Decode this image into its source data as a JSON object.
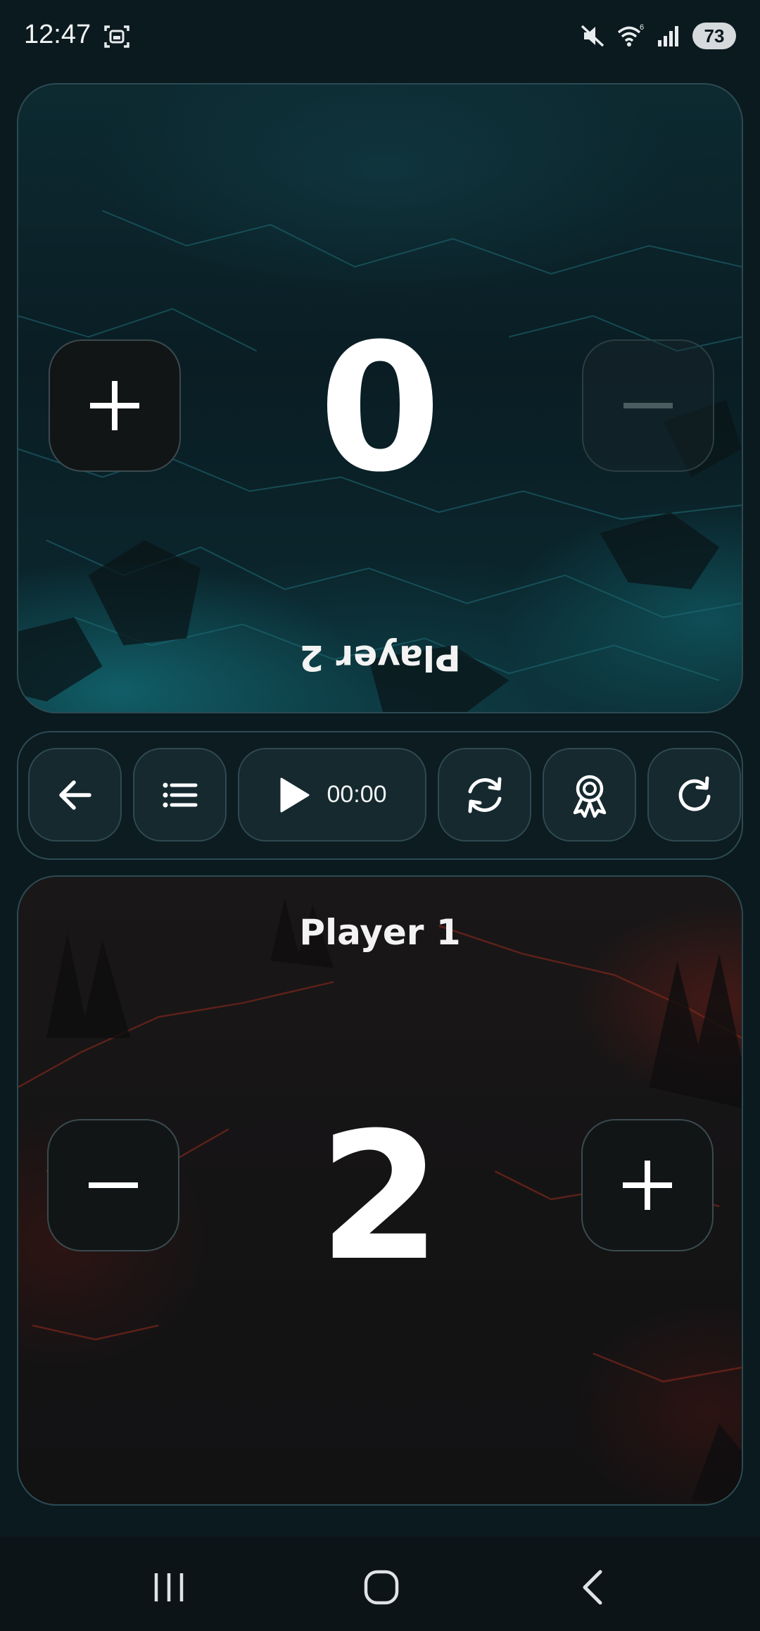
{
  "status_bar": {
    "time": "12:47",
    "battery": "73",
    "icons": [
      "screenshot-icon",
      "mute-icon",
      "wifi-icon",
      "signal-icon"
    ]
  },
  "player2": {
    "label": "Player 2",
    "score": "0",
    "theme": "teal-rock",
    "orientation": "upside-down",
    "buttons": [
      "plus-icon",
      "minus-icon"
    ]
  },
  "toolbar": {
    "timer": "00:00",
    "buttons": [
      "back-arrow-icon",
      "list-icon",
      "play-icon",
      "swap-icon",
      "award-icon",
      "reset-icon"
    ]
  },
  "player1": {
    "label": "Player 1",
    "score": "2",
    "theme": "lava-rock",
    "buttons": [
      "minus-icon",
      "plus-icon"
    ]
  },
  "nav_bar": {
    "buttons": [
      "recents-icon",
      "home-icon",
      "back-icon"
    ]
  },
  "colors": {
    "background": "#0b1a1f",
    "panel_border": "#2c4a52",
    "button_bg": "#121516",
    "toolbar_button_bg": "#15292f",
    "text": "#ffffff"
  }
}
